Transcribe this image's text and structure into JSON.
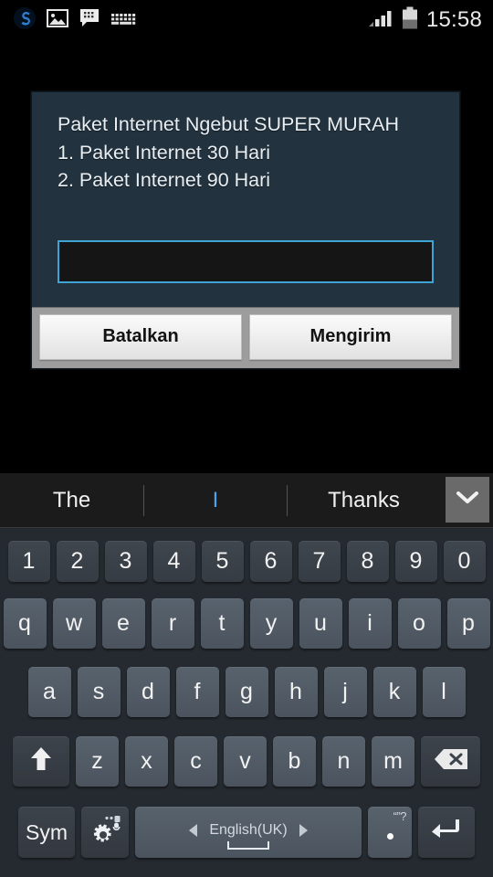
{
  "statusbar": {
    "icons": [
      {
        "name": "shareit-s-icon",
        "glyph": "S"
      },
      {
        "name": "gallery-image-icon",
        "glyph": "image"
      },
      {
        "name": "bbm-message-icon",
        "glyph": "chat"
      },
      {
        "name": "keyboard-icon",
        "glyph": "keyboard"
      }
    ],
    "signal_icon": "signal-bars-icon",
    "signal_bars": 4,
    "battery_icon": "battery-icon",
    "time": "15:58"
  },
  "dialog": {
    "message": "Paket Internet Ngebut SUPER MURAH\n1. Paket Internet 30 Hari\n2. Paket Internet 90 Hari",
    "input": {
      "value": "",
      "placeholder": ""
    },
    "cancel_label": "Batalkan",
    "send_label": "Mengirim",
    "background_color": "#22323e",
    "input_border_color": "#3fa3d4"
  },
  "keyboard": {
    "suggestions": [
      {
        "text": "The",
        "highlighted": false
      },
      {
        "text": "I",
        "highlighted": true
      },
      {
        "text": "Thanks",
        "highlighted": false
      }
    ],
    "expand_icon": "chevron-down-icon",
    "highlight_color": "#4da3e8",
    "rows": {
      "numbers": [
        "1",
        "2",
        "3",
        "4",
        "5",
        "6",
        "7",
        "8",
        "9",
        "0"
      ],
      "top": [
        "q",
        "w",
        "e",
        "r",
        "t",
        "y",
        "u",
        "i",
        "o",
        "p"
      ],
      "home": [
        "a",
        "s",
        "d",
        "f",
        "g",
        "h",
        "j",
        "k",
        "l"
      ],
      "bottom": [
        "z",
        "x",
        "c",
        "v",
        "b",
        "n",
        "m"
      ]
    },
    "shift_icon": "shift-arrow-up-icon",
    "backspace_icon": "backspace-delete-icon",
    "sym_label": "Sym",
    "settings_icon": "gear-microphone-icon",
    "space_label": "English(UK)",
    "space_prev_icon": "triangle-left-icon",
    "space_next_icon": "triangle-right-icon",
    "period_hint": "“”?",
    "period_label": ".",
    "enter_icon": "enter-return-icon"
  }
}
